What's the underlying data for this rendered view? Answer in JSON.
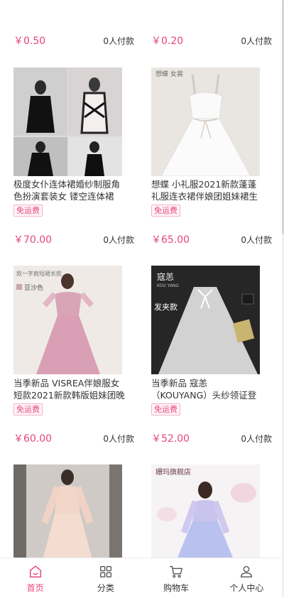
{
  "products": [
    {
      "price": "￥0.50",
      "sold": "0人付款"
    },
    {
      "price": "￥0.20",
      "sold": "0人付款"
    },
    {
      "title": "极度女仆连体裙婚纱制服角色扮演套装女 镂空连体裙【黑...",
      "badge": "免运费",
      "price": "￥70.00",
      "sold": "0人付款"
    },
    {
      "title": "想蝶 小礼服2021新款蓬蓬礼服连衣裙伴娘团姐妹裙生日会...",
      "badge": "免运费",
      "price": "￥65.00",
      "sold": "0人付款"
    },
    {
      "title": "当季新品 VISREA伴娘服女短款2021新款韩版姐妹团晚礼...",
      "badge": "免运费",
      "price": "￥60.00",
      "sold": "0人付款"
    },
    {
      "title": "当季新品 寇恙（KOUYANG）头纱领证登记新娘蝴蝶蓬蓬...",
      "badge": "免运费",
      "price": "￥52.00",
      "sold": "0人付款"
    }
  ],
  "image_text": {
    "p4_brand": "想蝶 女装",
    "p5_tag": "款一字肩短裙长款",
    "p5_color": "豆沙色",
    "p6_brand": "寇恙",
    "p6_brand_sub": "KOU YANG",
    "p6_tag": "发夹款",
    "p8_shop": "姗玛旗舰店"
  },
  "tabbar": {
    "tabs": [
      {
        "label": "首页",
        "icon": "home-icon",
        "active": true
      },
      {
        "label": "分类",
        "icon": "grid-icon",
        "active": false
      },
      {
        "label": "购物车",
        "icon": "cart-icon",
        "active": false
      },
      {
        "label": "个人中心",
        "icon": "user-icon",
        "active": false
      }
    ]
  },
  "colors": {
    "accent": "#e8457a"
  }
}
